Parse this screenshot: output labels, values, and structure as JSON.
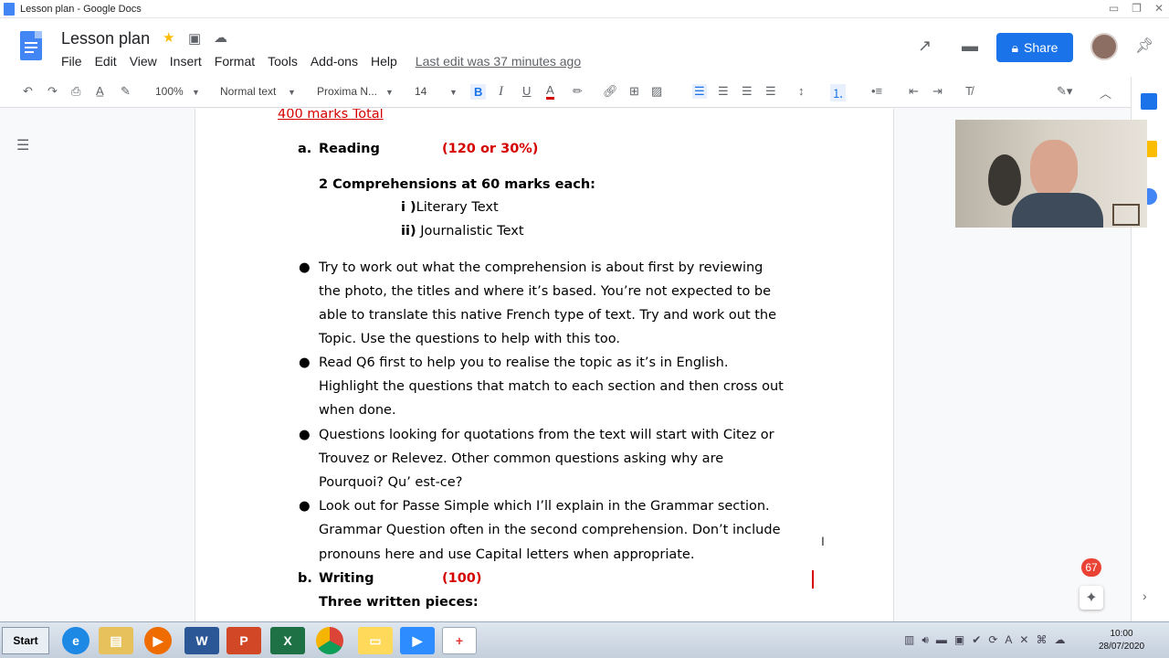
{
  "window": {
    "title": "Lesson plan - Google Docs"
  },
  "header": {
    "doc_title": "Lesson plan",
    "menu": [
      "File",
      "Edit",
      "View",
      "Insert",
      "Format",
      "Tools",
      "Add-ons",
      "Help"
    ],
    "last_edit": "Last edit was 37 minutes ago",
    "share_label": "Share"
  },
  "toolbar": {
    "zoom": "100%",
    "style": "Normal text",
    "font": "Proxima N...",
    "size": "14",
    "bold": "B",
    "italic": "I",
    "underline": "U",
    "text_color": "A"
  },
  "doc": {
    "top_line": "400 marks Total",
    "reading_label": "a.",
    "reading_title": "Reading",
    "reading_marks": "(120 or 30%)",
    "comprehensions": "2 Comprehensions at 60 marks each:",
    "lit_num": "i )",
    "lit_text": "Literary Text",
    "jour_num": "ii)",
    "jour_text": "Journalistic Text",
    "bullets": [
      [
        "Try to work out what the comprehension is about first by reviewing",
        "the photo, the titles and where it’s based. You’re not expected to be",
        "able to translate this native French type of text. Try and work out the",
        "Topic. Use the questions to help with this too."
      ],
      [
        "Read Q6 first to help you to realise the topic as it’s in English.",
        "Highlight the questions that match to each section and then cross out",
        "when done."
      ],
      [
        "Questions looking for quotations from the text will start with Citez or",
        "Trouvez or Relevez. Other common questions asking why are",
        "Pourquoi? Qu’ est-ce?"
      ],
      [
        "Look out for Passe Simple which I’ll explain in the Grammar section.",
        "Grammar Question often in the second comprehension. Don’t include",
        "pronouns here and use Capital letters when appropriate."
      ]
    ],
    "writing_label": "b.",
    "writing_title": "Writing",
    "writing_marks": "(100)",
    "three_pieces": "Three written pieces:"
  },
  "notifications": {
    "count": "67"
  },
  "taskbar": {
    "start_label": "Start",
    "time": "10:00",
    "date": "28/07/2020"
  },
  "colors": {
    "accent": "#1a73e8",
    "red_text": "#d50000"
  }
}
